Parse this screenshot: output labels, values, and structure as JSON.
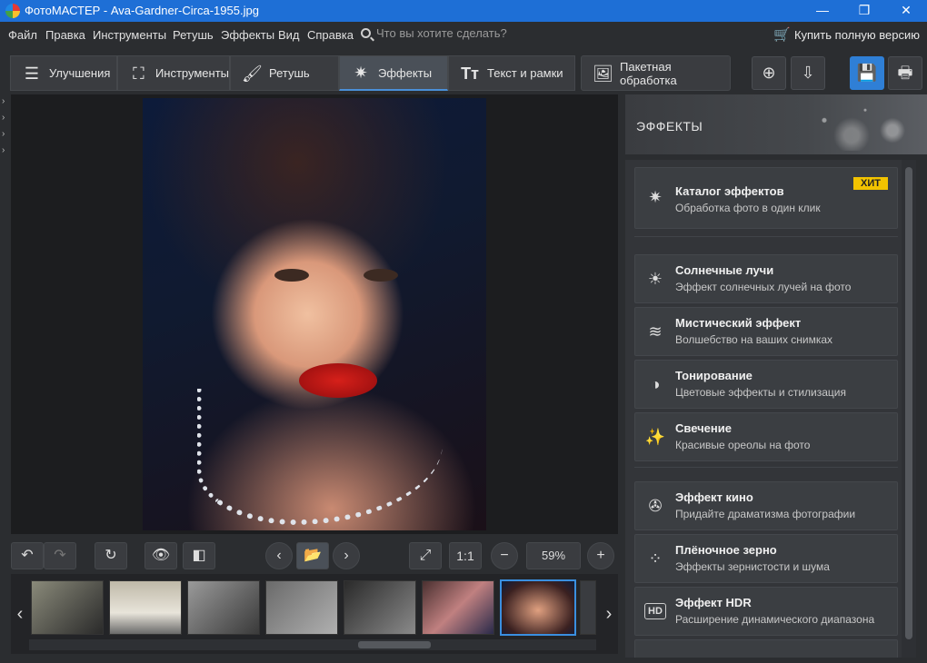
{
  "window": {
    "title": "ФотоМАСТЕР - Ava-Gardner-Circa-1955.jpg",
    "minimize": "—",
    "maximize": "❐",
    "close": "✕"
  },
  "menu": {
    "items": [
      "Файл",
      "Правка",
      "Инструменты",
      "Ретушь",
      "Эффекты",
      "Вид",
      "Справка"
    ],
    "search_placeholder": "Что вы хотите сделать?",
    "buy_label": "Купить полную версию"
  },
  "toolbar": {
    "tabs": [
      {
        "label": "Улучшения",
        "icon": "sliders-icon"
      },
      {
        "label": "Инструменты",
        "icon": "crop-icon"
      },
      {
        "label": "Ретушь",
        "icon": "brush-icon"
      },
      {
        "label": "Эффекты",
        "icon": "magic-wand-icon",
        "active": true
      },
      {
        "label": "Текст и рамки",
        "icon": "text-icon"
      },
      {
        "label": "Пакетная обработка",
        "icon": "image-stack-icon"
      }
    ]
  },
  "viewbar": {
    "fit_label": "1:1",
    "zoom": "59%"
  },
  "effects_panel": {
    "header": "ЭФФЕКТЫ",
    "catalog": {
      "title": "Каталог эффектов",
      "subtitle": "Обработка фото в один клик",
      "badge": "ХИТ"
    },
    "items": [
      {
        "title": "Солнечные лучи",
        "subtitle": "Эффект солнечных лучей на фото",
        "icon": "sun-icon"
      },
      {
        "title": "Мистический эффект",
        "subtitle": "Волшебство на ваших снимках",
        "icon": "mystic-icon"
      },
      {
        "title": "Тонирование",
        "subtitle": "Цветовые эффекты и стилизация",
        "icon": "toning-icon"
      },
      {
        "title": "Свечение",
        "subtitle": "Красивые ореолы на фото",
        "icon": "glow-icon"
      },
      {
        "title": "Эффект кино",
        "subtitle": "Придайте драматизма фотографии",
        "icon": "film-reel-icon"
      },
      {
        "title": "Плёночное зерно",
        "subtitle": "Эффекты зернистости и шума",
        "icon": "grain-icon"
      },
      {
        "title": "Эффект HDR",
        "subtitle": "Расширение динамического диапазона",
        "icon": "hdr-icon"
      }
    ]
  },
  "colors": {
    "accent": "#2f7fd6",
    "titlebar": "#1e6fd6",
    "badge": "#f2c300"
  }
}
